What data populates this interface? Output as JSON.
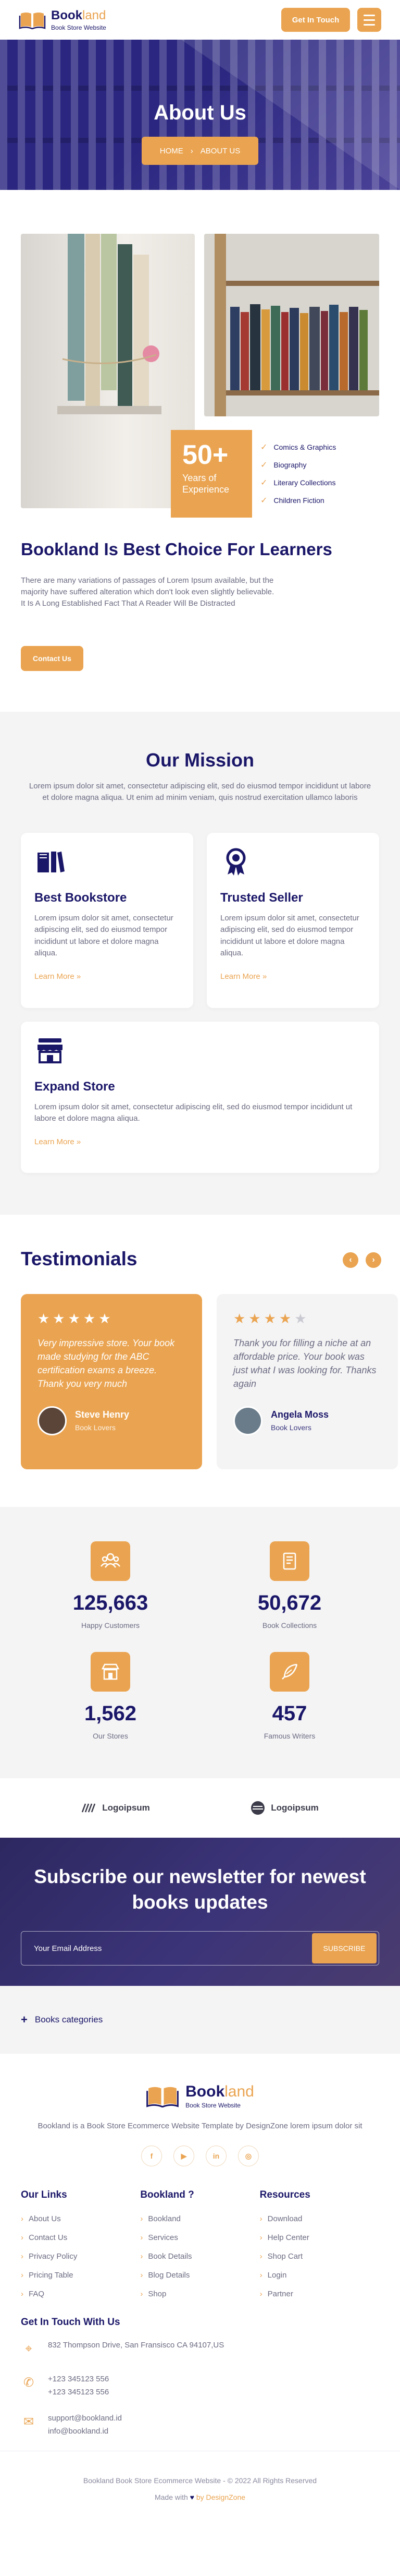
{
  "brand": {
    "name_main": "Book",
    "name_accent": "land",
    "tagline": "Book Store Website"
  },
  "header": {
    "cta": "Get In Touch"
  },
  "banner": {
    "title": "About Us",
    "crumb_home": "HOME",
    "crumb_sep": "›",
    "crumb_current": "ABOUT US"
  },
  "about": {
    "experience_value": "50+",
    "experience_label": "Years of Experience",
    "categories": [
      "Comics & Graphics",
      "Biography",
      "Literary Collections",
      "Children Fiction"
    ],
    "heading": "Bookland Is Best Choice For Learners",
    "paragraph": "There are many variations of passages of Lorem Ipsum available, but the majority have suffered alteration which don't look even slightly believable. It Is A Long Established Fact That A Reader Will Be Distracted",
    "button": "Contact Us"
  },
  "mission": {
    "title": "Our Mission",
    "subtitle": "Lorem ipsum dolor sit amet, consectetur adipiscing elit, sed do eiusmod tempor incididunt ut labore et dolore magna aliqua. Ut enim ad minim veniam, quis nostrud exercitation ullamco laboris",
    "cards": [
      {
        "title": "Best Bookstore",
        "text": "Lorem ipsum dolor sit amet, consectetur adipiscing elit, sed do eiusmod tempor incididunt ut labore et dolore magna aliqua.",
        "link": "Learn More »",
        "icon": "books-icon"
      },
      {
        "title": "Trusted Seller",
        "text": "Lorem ipsum dolor sit amet, consectetur adipiscing elit, sed do eiusmod tempor incididunt ut labore et dolore magna aliqua.",
        "link": "Learn More »",
        "icon": "award-icon"
      },
      {
        "title": "Expand Store",
        "text": "Lorem ipsum dolor sit amet, consectetur adipiscing elit, sed do eiusmod tempor incididunt ut labore et dolore magna aliqua.",
        "link": "Learn More »",
        "icon": "store-icon"
      }
    ]
  },
  "testimonials": {
    "title": "Testimonials",
    "prev": "‹",
    "next": "›",
    "items": [
      {
        "rating": 5,
        "quote": "Very impressive store. Your book made studying for the ABC certification exams a breeze. Thank you very much",
        "name": "Steve Henry",
        "role": "Book Lovers"
      },
      {
        "rating": 4,
        "quote": "Thank you for filling a niche at an affordable price. Your book was just what I was looking for. Thanks again",
        "name": "Angela Moss",
        "role": "Book Lovers"
      }
    ]
  },
  "stats": [
    {
      "value": "125,663",
      "label": "Happy Customers",
      "icon": "customers-icon"
    },
    {
      "value": "50,672",
      "label": "Book Collections",
      "icon": "book-collection-icon"
    },
    {
      "value": "1,562",
      "label": "Our Stores",
      "icon": "store-icon"
    },
    {
      "value": "457",
      "label": "Famous Writers",
      "icon": "quill-icon"
    }
  ],
  "partners": [
    "Logoipsum",
    "Logoipsum"
  ],
  "newsletter": {
    "title": "Subscribe our newsletter for newest books updates",
    "placeholder": "Your Email Address",
    "button": "SUBSCRIBE"
  },
  "book_categories": {
    "label": "Books categories",
    "toggle": "+"
  },
  "footer": {
    "description": "Bookland is a Book Store Ecommerce Website Template by DesignZone lorem ipsum dolor sit",
    "socials": [
      "f",
      "▶",
      "in",
      "◎"
    ],
    "col1": {
      "title": "Our Links",
      "items": [
        "About Us",
        "Contact Us",
        "Privacy Policy",
        "Pricing Table",
        "FAQ"
      ]
    },
    "col2": {
      "title": "Bookland ?",
      "items": [
        "Bookland",
        "Services",
        "Book Details",
        "Blog Details",
        "Shop"
      ]
    },
    "col3": {
      "title": "Resources",
      "items": [
        "Download",
        "Help Center",
        "Shop Cart",
        "Login",
        "Partner"
      ]
    },
    "contact_title": "Get In Touch With Us",
    "address": "832 Thompson Drive, San Fransisco CA 94107,US",
    "phone1": "+123 345123 556",
    "phone2": "+123 345123 556",
    "email1": "support@bookland.id",
    "email2": "info@bookland.id",
    "copyright": "Bookland Book Store Ecommerce Website - © 2022 All Rights Reserved",
    "made_with": "Made with",
    "made_by": "by DesignZone"
  },
  "colors": {
    "accent": "#eaa451",
    "navy": "#1a1668",
    "muted": "#6b6b82",
    "light_bg": "#f4f4f5"
  }
}
